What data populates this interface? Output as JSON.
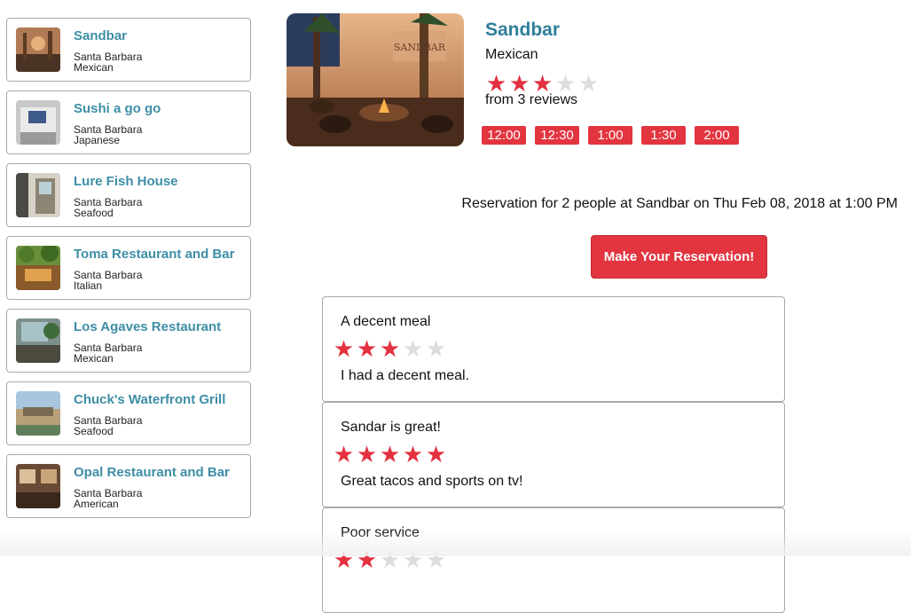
{
  "sidebar": {
    "restaurants": [
      {
        "name": "Sandbar",
        "city": "Santa Barbara",
        "cuisine": "Mexican",
        "thumb": "patio-photo"
      },
      {
        "name": "Sushi a go go",
        "city": "Santa Barbara",
        "cuisine": "Japanese",
        "thumb": "storefront-photo"
      },
      {
        "name": "Lure Fish House",
        "city": "Santa Barbara",
        "cuisine": "Seafood",
        "thumb": "street-photo"
      },
      {
        "name": "Toma Restaurant and Bar",
        "city": "Santa Barbara",
        "cuisine": "Italian",
        "thumb": "terrace-photo"
      },
      {
        "name": "Los Agaves Restaurant",
        "city": "Santa Barbara",
        "cuisine": "Mexican",
        "thumb": "courtyard-photo"
      },
      {
        "name": "Chuck's Waterfront Grill",
        "city": "Santa Barbara",
        "cuisine": "Seafood",
        "thumb": "harbor-photo"
      },
      {
        "name": "Opal Restaurant and Bar",
        "city": "Santa Barbara",
        "cuisine": "American",
        "thumb": "interior-photo"
      }
    ]
  },
  "detail": {
    "name": "Sandbar",
    "cuisine": "Mexican",
    "rating": 3,
    "max_rating": 5,
    "reviews_text": "from 3 reviews",
    "times": [
      "12:00",
      "12:30",
      "1:00",
      "1:30",
      "2:00"
    ],
    "reservation_text": "Reservation for 2 people at Sandbar on Thu Feb 08, 2018 at 1:00 PM",
    "reserve_label": "Make Your Reservation!"
  },
  "reviews": [
    {
      "title": "A decent meal",
      "rating": 3,
      "body": "I had a decent meal."
    },
    {
      "title": "Sandar is great!",
      "rating": 5,
      "body": "Great tacos and sports on tv!"
    },
    {
      "title": "Poor service",
      "rating": 2,
      "body": ""
    }
  ],
  "colors": {
    "accent": "#e23540",
    "link": "#3e8ea6",
    "star_on": "#e3313f",
    "star_off": "#dddddd"
  }
}
